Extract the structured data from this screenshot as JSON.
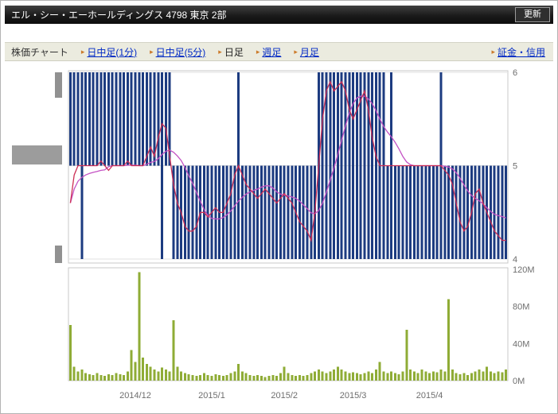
{
  "header": {
    "title": "エル・シー・エーホールディングス  4798  東京 2部",
    "update_button": "更新"
  },
  "nav": {
    "section_label": "株価チャート",
    "tabs": [
      {
        "label": "日中足(1分)"
      },
      {
        "label": "日中足(5分)"
      },
      {
        "label": "日足"
      },
      {
        "label": "週足"
      },
      {
        "label": "月足"
      },
      {
        "label": "証金・信用"
      }
    ]
  },
  "chart_data": {
    "type": "bar",
    "subtype": "daily price range bars with close line, moving-average line and volume",
    "n_points": 115,
    "colors": {
      "bar": "#1c3b80",
      "close_line": "#cc2e55",
      "ma_line": "#c452c4",
      "volume_bar": "#8fac36",
      "grid": "#e0e0e0",
      "plot_border": "#c8c8c8"
    },
    "price": {
      "ylim": [
        3.95,
        6.02
      ],
      "ma_period": 10,
      "y_ticks": [
        {
          "label": "6",
          "value": 6
        },
        {
          "label": "5",
          "value": 5
        },
        {
          "label": "4",
          "value": 4
        }
      ],
      "highs": [
        6,
        6,
        6,
        6,
        6,
        6,
        6,
        6,
        6,
        6,
        6,
        6,
        6,
        6,
        6,
        6,
        6,
        6,
        6,
        6,
        6,
        6,
        6,
        6,
        6,
        6,
        6,
        5,
        5,
        5,
        5,
        5,
        5,
        5,
        5,
        5,
        5,
        5,
        5,
        5,
        5,
        5,
        5,
        5,
        6,
        5,
        5,
        5,
        5,
        5,
        5,
        5,
        5,
        5,
        5,
        5,
        5,
        5,
        5,
        5,
        5,
        5,
        5,
        5,
        5,
        6,
        6,
        6,
        6,
        6,
        6,
        6,
        6,
        6,
        6,
        6,
        6,
        6,
        6,
        6,
        6,
        6,
        6,
        5,
        6,
        5,
        5,
        5,
        5,
        5,
        5,
        5,
        5,
        5,
        5,
        5,
        5,
        6,
        5,
        5,
        5,
        5,
        5,
        5,
        5,
        5,
        5,
        5,
        5,
        5,
        5,
        5,
        5,
        5,
        5
      ],
      "lows": [
        5,
        5,
        5,
        4,
        5,
        5,
        5,
        5,
        5,
        5,
        5,
        5,
        5,
        5,
        5,
        5,
        5,
        5,
        5,
        5,
        5,
        5,
        5,
        5,
        4,
        5,
        5,
        4,
        4,
        4,
        4,
        4,
        4,
        4,
        4,
        4,
        4,
        4,
        4,
        4,
        4,
        4,
        4,
        4,
        4,
        4,
        4,
        4,
        4,
        4,
        4,
        4,
        4,
        4,
        4,
        4,
        4,
        4,
        4,
        4,
        4,
        4,
        4,
        4,
        4,
        4,
        4,
        4,
        4,
        4,
        4,
        4,
        4,
        4,
        4,
        4,
        4,
        4,
        4,
        4,
        4,
        4,
        4,
        4,
        4,
        4,
        4,
        4,
        4,
        4,
        4,
        4,
        4,
        4,
        4,
        4,
        4,
        4,
        4,
        4,
        4,
        4,
        4,
        4,
        4,
        4,
        4,
        4,
        4,
        4,
        4,
        4,
        4,
        4,
        4
      ],
      "closes": [
        4.6,
        4.9,
        5,
        5,
        5,
        5,
        5,
        5,
        5.05,
        5,
        4.95,
        5,
        5,
        5,
        5,
        5.05,
        5,
        5,
        5,
        5,
        5.1,
        5.2,
        5.1,
        5.3,
        5.45,
        5.4,
        5.1,
        4.8,
        4.6,
        4.5,
        4.35,
        4.3,
        4.3,
        4.35,
        4.5,
        4.5,
        4.45,
        4.5,
        4.55,
        4.5,
        4.5,
        4.6,
        4.7,
        4.9,
        5,
        4.9,
        4.8,
        4.75,
        4.7,
        4.65,
        4.7,
        4.75,
        4.7,
        4.65,
        4.6,
        4.65,
        4.7,
        4.65,
        4.6,
        4.5,
        4.4,
        4.35,
        4.3,
        4.2,
        4.5,
        5,
        5.5,
        5.8,
        5.9,
        5.8,
        5.85,
        5.9,
        5.8,
        5.6,
        5.5,
        5.6,
        5.7,
        5.8,
        5.6,
        5.3,
        5.1,
        5,
        5,
        5,
        5,
        5,
        5,
        5,
        5,
        5,
        5,
        5,
        5,
        5,
        5,
        5,
        5,
        5,
        4.95,
        4.9,
        4.8,
        4.6,
        4.4,
        4.3,
        4.35,
        4.5,
        4.7,
        4.75,
        4.6,
        4.5,
        4.4,
        4.3,
        4.25,
        4.2,
        4.2
      ]
    },
    "volume": {
      "unit": "M",
      "ylim_millions": [
        0,
        120
      ],
      "y_ticks": [
        {
          "label": "120M",
          "value": 120
        },
        {
          "label": "80M",
          "value": 80
        },
        {
          "label": "40M",
          "value": 40
        },
        {
          "label": "0M",
          "value": 0
        }
      ],
      "values_millions": [
        60,
        15,
        10,
        12,
        8,
        7,
        6,
        8,
        6,
        5,
        7,
        6,
        8,
        7,
        6,
        10,
        33,
        20,
        117,
        25,
        18,
        15,
        12,
        10,
        14,
        12,
        10,
        65,
        15,
        10,
        8,
        7,
        6,
        5,
        6,
        8,
        6,
        5,
        7,
        6,
        5,
        6,
        8,
        10,
        18,
        10,
        8,
        6,
        5,
        6,
        5,
        4,
        5,
        6,
        5,
        8,
        15,
        8,
        6,
        5,
        6,
        5,
        6,
        8,
        10,
        12,
        10,
        8,
        10,
        12,
        15,
        12,
        10,
        8,
        9,
        8,
        7,
        8,
        10,
        8,
        12,
        20,
        10,
        8,
        10,
        8,
        7,
        10,
        55,
        12,
        10,
        8,
        12,
        10,
        8,
        10,
        9,
        12,
        10,
        88,
        12,
        8,
        7,
        8,
        6,
        8,
        10,
        12,
        10,
        15,
        10,
        8,
        10,
        9,
        12
      ]
    },
    "x_ticks": [
      {
        "label": "2014/12",
        "index": 17
      },
      {
        "label": "2015/1",
        "index": 37
      },
      {
        "label": "2015/2",
        "index": 56
      },
      {
        "label": "2015/3",
        "index": 74
      },
      {
        "label": "2015/4",
        "index": 94
      }
    ]
  }
}
